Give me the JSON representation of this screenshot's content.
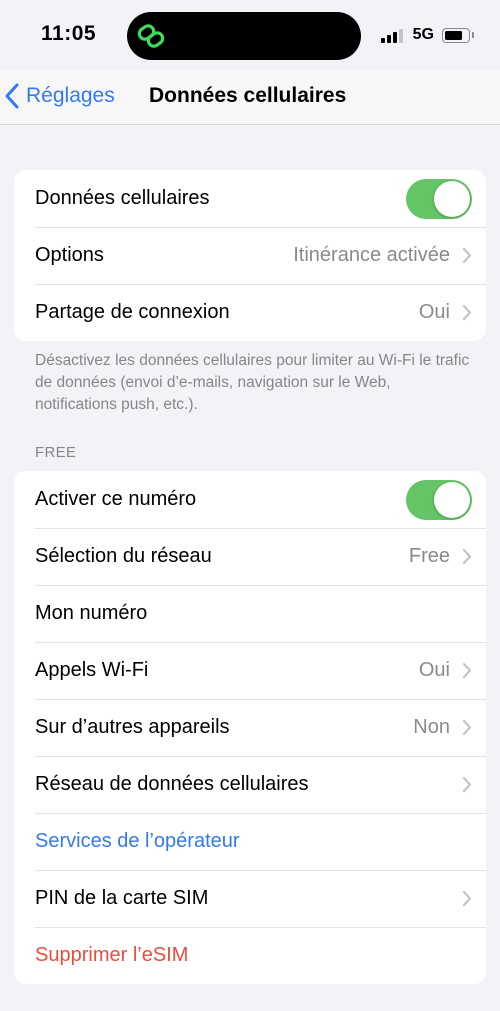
{
  "status_bar": {
    "time": "11:05",
    "network": "5G",
    "signal_bars_filled": 3,
    "signal_bars_total": 4,
    "island_icon": "link-app-icon"
  },
  "nav": {
    "back_label": "Réglages",
    "title": "Données cellulaires"
  },
  "group1": {
    "cellular_data": {
      "label": "Données cellulaires",
      "toggle_on": true
    },
    "options": {
      "label": "Options",
      "value": "Itinérance activée"
    },
    "hotspot": {
      "label": "Partage de connexion",
      "value": "Oui"
    }
  },
  "footer_note": "Désactivez les données cellulaires pour limiter au Wi-Fi le trafic de données (envoi d’e-mails, navigation sur le Web, notifications push, etc.).",
  "section_header": "FREE",
  "group2": {
    "activate_number": {
      "label": "Activer ce numéro",
      "toggle_on": true
    },
    "network_selection": {
      "label": "Sélection du réseau",
      "value": "Free"
    },
    "my_number": {
      "label": "Mon numéro",
      "value": ""
    },
    "wifi_calling": {
      "label": "Appels Wi-Fi",
      "value": "Oui"
    },
    "other_devices": {
      "label": "Sur d’autres appareils",
      "value": "Non"
    },
    "cellular_network": {
      "label": "Réseau de données cellulaires"
    },
    "carrier_services": {
      "label": "Services de l’opérateur"
    },
    "sim_pin": {
      "label": "PIN de la carte SIM"
    },
    "delete_esim": {
      "label": "Supprimer l’eSIM"
    }
  },
  "colors": {
    "accent_blue": "#3478f6",
    "toggle_green": "#65c466",
    "destructive_red": "#eb4c3e",
    "island_icon_green": "#3ddc5a"
  }
}
